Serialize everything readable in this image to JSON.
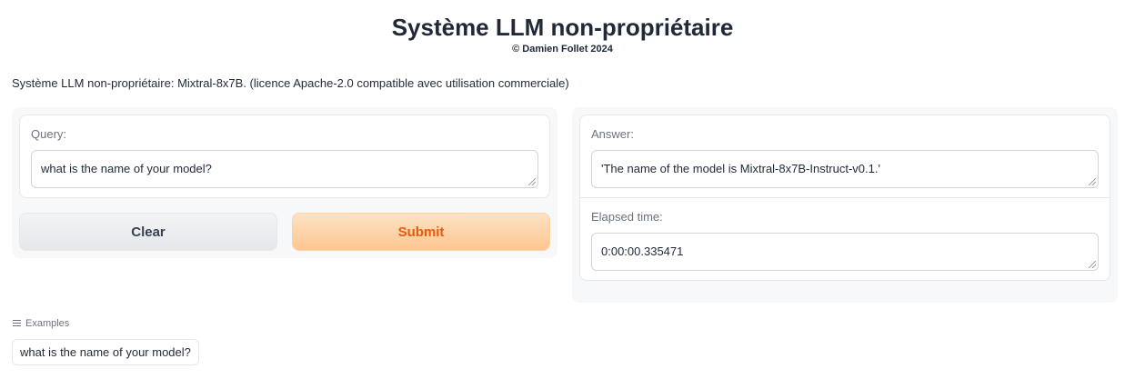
{
  "header": {
    "title": "Système LLM non-propriétaire",
    "subtitle": "© Damien Follet 2024"
  },
  "description": "Système LLM non-propriétaire: Mixtral-8x7B. (licence Apache-2.0 compatible avec utilisation commerciale)",
  "query": {
    "label": "Query:",
    "value": "what is the name of your model?"
  },
  "buttons": {
    "clear_label": "Clear",
    "submit_label": "Submit"
  },
  "answer": {
    "label": "Answer:",
    "value": "'The name of the model is Mixtral-8x7B-Instruct-v0.1.'"
  },
  "elapsed": {
    "label": "Elapsed time:",
    "value": "0:00:00.335471"
  },
  "examples": {
    "header_label": "Examples",
    "icon": "list-icon",
    "items": [
      "what is the name of your model?"
    ]
  },
  "colors": {
    "accent": "#ea580c",
    "submit_bg": "#fdc690",
    "panel_bg": "#f7f8fa"
  }
}
